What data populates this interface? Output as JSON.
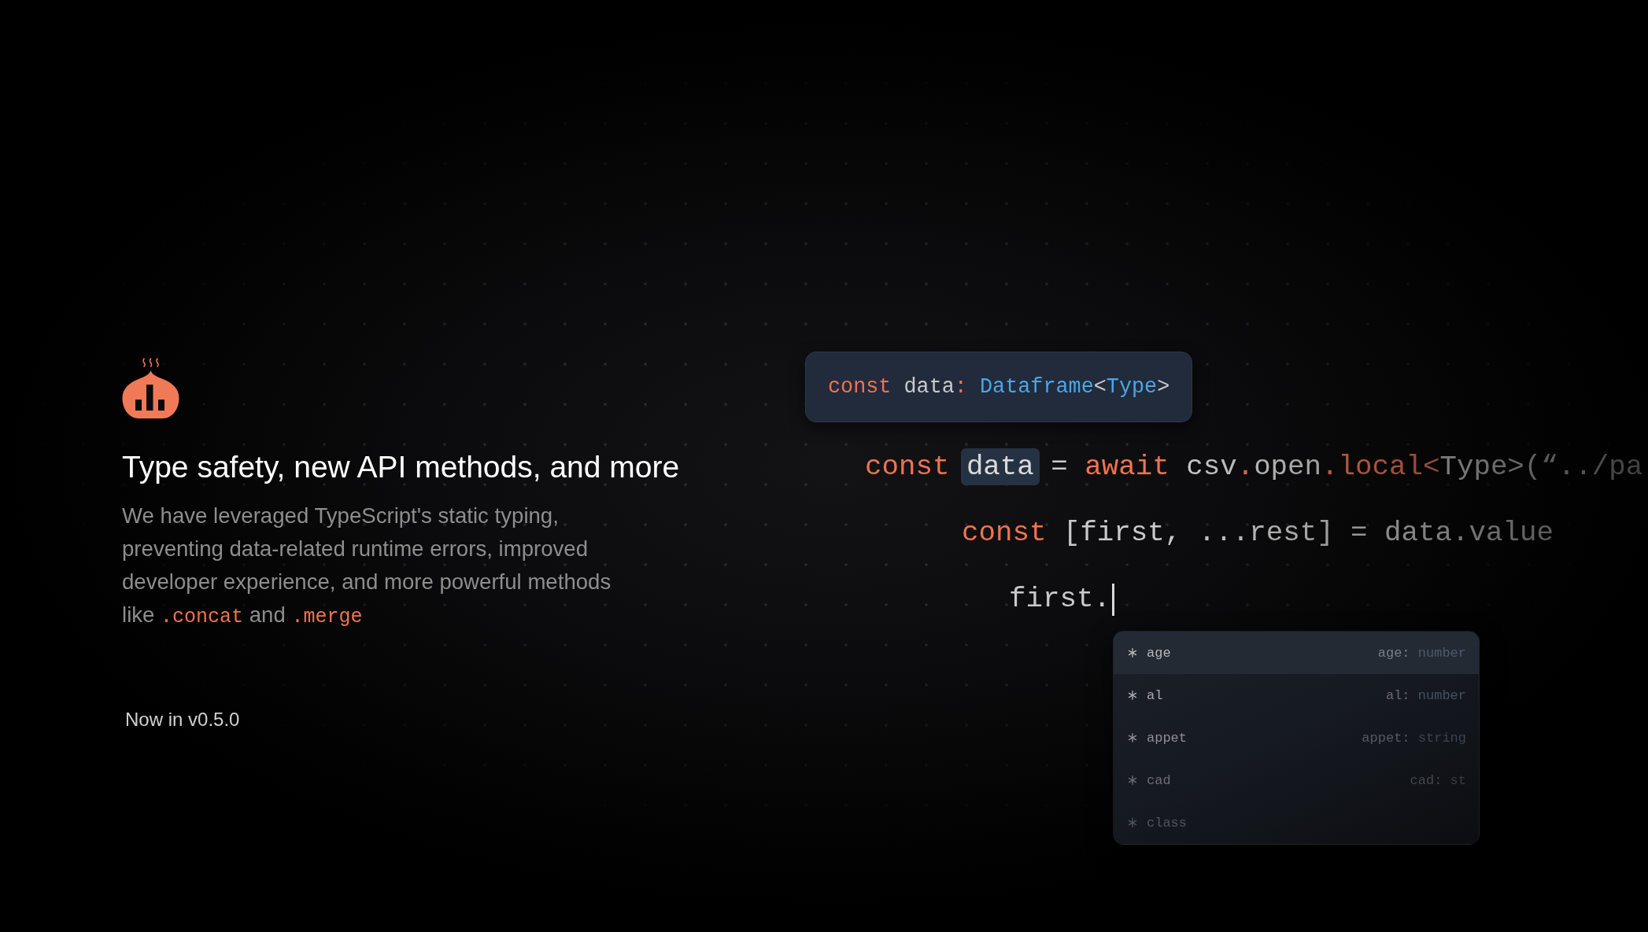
{
  "hero": {
    "title": "Type safety, new API methods, and more",
    "description": [
      {
        "kind": "text",
        "text": "We have leveraged TypeScript's static typing, preventing data-related runtime errors, improved developer experience, and more powerful methods like "
      },
      {
        "kind": "code",
        "text": ".concat"
      },
      {
        "kind": "text",
        "text": " and "
      },
      {
        "kind": "code",
        "text": ".merge"
      }
    ],
    "version": "Now in v0.5.0"
  },
  "code_preview": {
    "tooltip": [
      {
        "kind": "keyword",
        "text": "const"
      },
      {
        "kind": "plain",
        "text": " data"
      },
      {
        "kind": "keyword",
        "text": ":"
      },
      {
        "kind": "type",
        "text": " Dataframe"
      },
      {
        "kind": "plain",
        "text": "<"
      },
      {
        "kind": "type",
        "text": "Type"
      },
      {
        "kind": "plain",
        "text": ">"
      }
    ],
    "lines": [
      {
        "tokens": [
          {
            "kind": "keyword",
            "text": "const "
          },
          {
            "kind": "highlight",
            "text": "data"
          },
          {
            "kind": "plain",
            "text": " = "
          },
          {
            "kind": "keyword",
            "text": "await"
          },
          {
            "kind": "plain",
            "text": " csv"
          },
          {
            "kind": "keyword",
            "text": "."
          },
          {
            "kind": "plain",
            "text": "open"
          },
          {
            "kind": "keyword",
            "text": ".local<"
          },
          {
            "kind": "plain",
            "text": "Type>(“../pa"
          }
        ],
        "cursor": false,
        "children": [
          {
            "tokens": [
              {
                "kind": "keyword",
                "text": "const"
              },
              {
                "kind": "plain",
                "text": " [first, ...rest] = data.value"
              }
            ],
            "cursor": false,
            "children": [
              {
                "tokens": [
                  {
                    "kind": "plain",
                    "text": "first."
                  }
                ],
                "cursor": true
              }
            ]
          }
        ]
      }
    ],
    "autocomplete": [
      {
        "label": "age",
        "hint": [
          {
            "kind": "plain",
            "text": "age: "
          },
          {
            "kind": "type",
            "text": "number"
          }
        ],
        "selected": true
      },
      {
        "label": "al",
        "hint": [
          {
            "kind": "plain",
            "text": "al: "
          },
          {
            "kind": "type",
            "text": "number"
          }
        ],
        "selected": false
      },
      {
        "label": "appet",
        "hint": [
          {
            "kind": "plain",
            "text": "appet: "
          },
          {
            "kind": "type",
            "text": "string"
          }
        ],
        "selected": false
      },
      {
        "label": "cad",
        "hint": [
          {
            "kind": "plain",
            "text": "cad: "
          },
          {
            "kind": "type",
            "text": "st"
          }
        ],
        "selected": false
      },
      {
        "label": "class",
        "selected": false
      }
    ]
  }
}
